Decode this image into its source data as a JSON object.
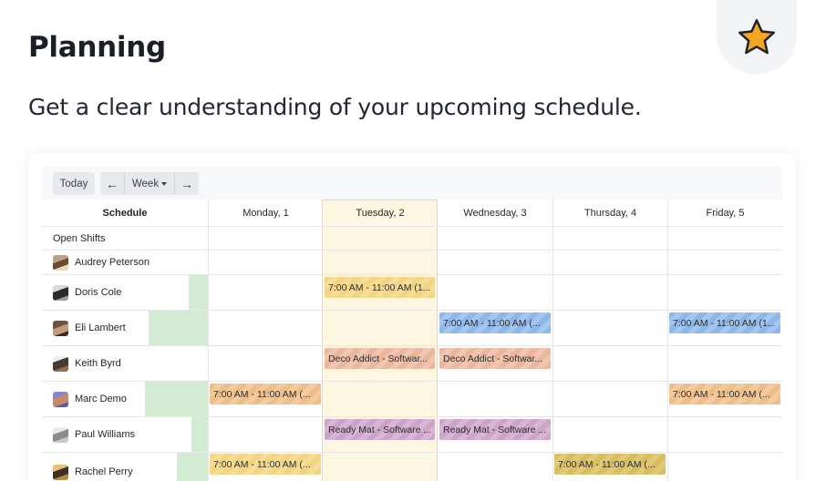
{
  "page": {
    "title": "Planning",
    "subtitle": "Get a clear understanding of your upcoming schedule.",
    "badge_icon": "star-icon"
  },
  "toolbar": {
    "today_label": "Today",
    "prev_icon": "←",
    "view_label": "Week",
    "next_icon": "→"
  },
  "schedule": {
    "header_label": "Schedule",
    "days": [
      "Monday, 1",
      "Tuesday, 2",
      "Wednesday, 3",
      "Thursday, 4",
      "Friday, 5"
    ],
    "highlighted_day": "Tuesday, 2",
    "rows": [
      {
        "name": "Open Shifts"
      },
      {
        "name": "Audrey Peterson"
      },
      {
        "name": "Doris Cole"
      },
      {
        "name": "Eli Lambert"
      },
      {
        "name": "Keith Byrd"
      },
      {
        "name": "Marc Demo"
      },
      {
        "name": "Paul Williams"
      },
      {
        "name": "Rachel Perry"
      }
    ],
    "shifts": {
      "doris_tue": "7:00 AM - 11:00 AM (1...",
      "eli_wed": "7:00 AM - 11:00 AM (...",
      "eli_fri": "7:00 AM - 11:00 AM (1...",
      "keith_tue": "Deco Addict - Softwar...",
      "keith_wed": "Deco Addict - Softwar...",
      "marc_mon": "7:00 AM - 11:00 AM (...",
      "marc_fri": "7:00 AM - 11:00 AM (...",
      "paul_tue": "Ready Mat - Software ...",
      "paul_wed": "Ready Mat - Software ...",
      "rachel_mon": "7:00 AM - 11:00 AM (...",
      "rachel_thu": "7:00 AM - 11:00 AM (..."
    }
  },
  "colors": {
    "yellow": "#f3d482",
    "blue": "#8db7e8",
    "salmon": "#eab69d",
    "orange": "#efbd8a",
    "purple": "#cda3c9",
    "olive": "#d8bd5f",
    "today_highlight": "#fdf6e0",
    "workload_bar": "#d3ead3"
  }
}
